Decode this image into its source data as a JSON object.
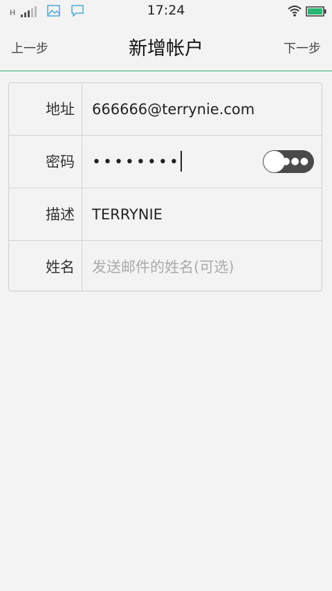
{
  "status_bar": {
    "network_type": "H",
    "time": "17:24"
  },
  "header": {
    "prev_label": "上一步",
    "title": "新增帐户",
    "next_label": "下一步"
  },
  "form": {
    "address": {
      "label": "地址",
      "value": "666666@terrynie.com"
    },
    "password": {
      "label": "密码",
      "value": "••••••••",
      "show_password": false
    },
    "description": {
      "label": "描述",
      "value": "TERRYNIE"
    },
    "name": {
      "label": "姓名",
      "value": "",
      "placeholder": "发送邮件的姓名(可选)"
    }
  },
  "colors": {
    "accent": "#2bb673",
    "battery": "#2bb673",
    "status_icon": "#4aa8d8"
  }
}
